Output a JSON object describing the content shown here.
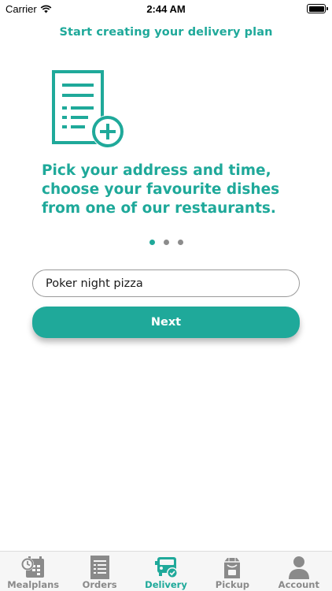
{
  "status_bar": {
    "carrier": "Carrier",
    "time": "2:44 AM"
  },
  "header": {
    "title": "Start creating your delivery plan"
  },
  "onboarding": {
    "illustration_icon": "document-add-icon",
    "headline_lines": [
      "Pick your address and time,",
      "choose your favourite dishes",
      "from one of our restaurants."
    ],
    "page_count": 3,
    "current_page": 1
  },
  "plan_name_input": {
    "value": "Poker night pizza"
  },
  "next_button": {
    "label": "Next"
  },
  "tab_bar": {
    "tabs": [
      {
        "label": "Mealplans",
        "icon": "calendar-clock-icon",
        "active": false
      },
      {
        "label": "Orders",
        "icon": "order-list-icon",
        "active": false
      },
      {
        "label": "Delivery",
        "icon": "delivery-truck-icon",
        "active": true
      },
      {
        "label": "Pickup",
        "icon": "takeout-bag-icon",
        "active": false
      },
      {
        "label": "Account",
        "icon": "person-icon",
        "active": false
      }
    ]
  },
  "colors": {
    "accent": "#1fa99a",
    "inactive_tab": "#8a8a8a",
    "inactive_dot": "#8c8c8c"
  }
}
